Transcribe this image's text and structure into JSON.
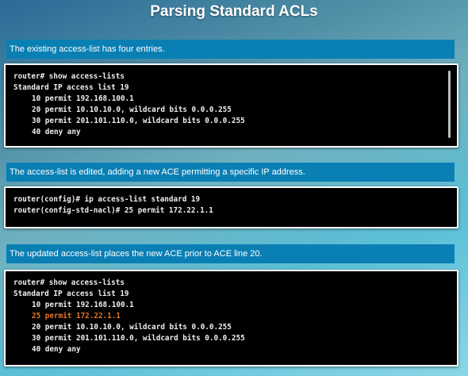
{
  "title": "Parsing Standard ACLs",
  "colors": {
    "banner": "#0a7fb4",
    "highlight": "#e87722"
  },
  "sections": [
    {
      "banner": "The existing access-list has four entries.",
      "lines": [
        "router# show access-lists",
        "Standard IP access list 19",
        "10 permit 192.168.100.1",
        "20 permit 10.10.10.0, wildcard bits 0.0.0.255",
        "30 permit 201.101.110.0, wildcard bits 0.0.0.255",
        "40 deny any"
      ]
    },
    {
      "banner": "The access-list is edited, adding a new ACE permitting a specific IP address.",
      "lines": [
        "router(config)# ip access-list standard 19",
        "router(config-std-nacl)# 25 permit 172.22.1.1"
      ]
    },
    {
      "banner": "The updated access-list places the new ACE prior to ACE line 20.",
      "lines": [
        "router# show access-lists",
        "Standard IP access list 19",
        "10 permit 192.168.100.1",
        "25 permit 172.22.1.1",
        "20 permit 10.10.10.0, wildcard bits 0.0.0.255",
        "30 permit 201.101.110.0, wildcard bits 0.0.0.255",
        "40 deny any"
      ]
    }
  ]
}
